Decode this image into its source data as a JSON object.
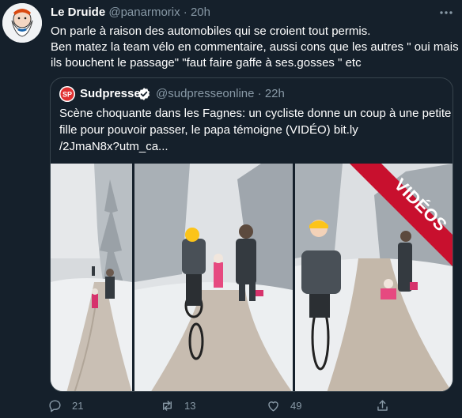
{
  "tweet": {
    "author_name": "Le Druide",
    "author_handle": "@panarmorix",
    "separator": "·",
    "time": "20h",
    "text_lines": [
      "On parle à raison des automobiles qui se croient tout permis.",
      "Ben matez la team vélo en commentaire, aussi cons que les autres \" oui mais",
      "ils bouchent le passage\" \"faut faire gaffe à ses.gosses \" etc"
    ]
  },
  "quote": {
    "logo_text": "SP",
    "author_name": "Sudpresse",
    "author_handle": "@sudpresseonline",
    "separator": "·",
    "time": "22h",
    "text_lines": [
      "Scène choquante dans les Fagnes: un cycliste donne un coup à une petite",
      "fille pour pouvoir passer, le papa témoigne (VIDÉO) bit.ly",
      "/2JmaN8x?utm_ca..."
    ],
    "media_banner": "VIDÉOS"
  },
  "actions": {
    "reply_count": "21",
    "retweet_count": "13",
    "like_count": "49"
  },
  "icons": {
    "more": "more-horizontal-icon",
    "verified": "verified-badge-icon",
    "reply": "reply-icon",
    "retweet": "retweet-icon",
    "like": "heart-icon",
    "share": "share-icon"
  },
  "colors": {
    "background": "#15202b",
    "border": "#38444d",
    "muted": "#8899a6",
    "banner": "#c8102e",
    "verified": "#1da1f2"
  }
}
